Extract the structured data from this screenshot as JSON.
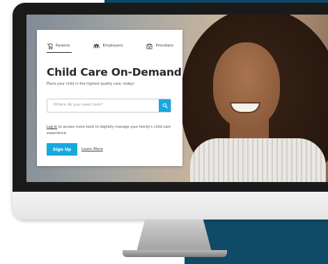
{
  "tabs": [
    {
      "label": "Parents",
      "icon": "stroller-icon",
      "active": true
    },
    {
      "label": "Employers",
      "icon": "people-group-icon",
      "active": false
    },
    {
      "label": "Providers",
      "icon": "building-icon",
      "active": false
    }
  ],
  "hero": {
    "title": "Child Care On-Demand",
    "subtitle": "Place your child in the highest quality care, today!"
  },
  "search": {
    "placeholder": "Where do you need care?",
    "button_icon": "search-icon"
  },
  "login": {
    "link_label": "Log in",
    "text": " to access more tools to digitally manage your family's child care experience."
  },
  "actions": {
    "signup_label": "Sign Up",
    "learn_more_label": "Learn More"
  },
  "colors": {
    "accent": "#17a8de",
    "backdrop": "#0f4a66"
  }
}
